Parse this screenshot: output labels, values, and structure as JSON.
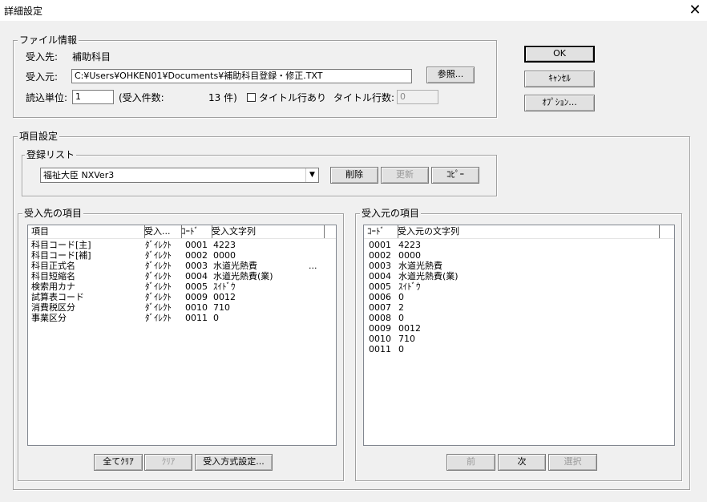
{
  "window": {
    "title": "詳細設定",
    "close_symbol": "✕"
  },
  "file_info": {
    "legend": "ファイル情報",
    "dest_label": "受入先:",
    "dest_value": "補助科目",
    "source_label": "受入元:",
    "source_value": "C:¥Users¥OHKEN01¥Documents¥補助科目登録・修正.TXT",
    "browse_button": "参照...",
    "unit_label": "読込単位:",
    "unit_value": "1",
    "count_prefix": "(受入件数:",
    "count_value": "13 件)",
    "title_row_label": "タイトル行あり",
    "title_row_count_label": "タイトル行数:",
    "title_row_count_value": "0"
  },
  "actions": {
    "ok": "OK",
    "cancel": "ｷｬﾝｾﾙ",
    "options": "ｵﾌﾟｼｮﾝ..."
  },
  "item_settings": {
    "legend": "項目設定",
    "registration": {
      "legend": "登録リスト",
      "selected": "福祉大臣 NXVer3",
      "delete_button": "削除",
      "update_button": "更新",
      "copy_button": "ｺﾋﾟｰ"
    },
    "dest_items": {
      "legend": "受入先の項目",
      "columns": [
        "項目",
        "受入...",
        "ｺｰﾄﾞ",
        "受入文字列"
      ],
      "rows": [
        [
          "科目コード[主]",
          "ﾀﾞｲﾚｸﾄ",
          "0001",
          "4223"
        ],
        [
          "科目コード[補]",
          "ﾀﾞｲﾚｸﾄ",
          "0002",
          "0000"
        ],
        [
          "科目正式名",
          "ﾀﾞｲﾚｸﾄ",
          "0003",
          "水道光熱費"
        ],
        [
          "科目短縮名",
          "ﾀﾞｲﾚｸﾄ",
          "0004",
          "水道光熱費(業)"
        ],
        [
          "検索用カナ",
          "ﾀﾞｲﾚｸﾄ",
          "0005",
          "ｽｲﾄﾞｳ"
        ],
        [
          "試算表コード",
          "ﾀﾞｲﾚｸﾄ",
          "0009",
          "0012"
        ],
        [
          "消費税区分",
          "ﾀﾞｲﾚｸﾄ",
          "0010",
          "710"
        ],
        [
          "事業区分",
          "ﾀﾞｲﾚｸﾄ",
          "0011",
          "0"
        ]
      ],
      "overflow_mark": "...",
      "clear_all_button": "全てｸﾘｱ",
      "clear_button": "ｸﾘｱ",
      "method_button": "受入方式設定..."
    },
    "source_items": {
      "legend": "受入元の項目",
      "columns": [
        "ｺｰﾄﾞ",
        "受入元の文字列"
      ],
      "rows": [
        [
          "0001",
          "4223"
        ],
        [
          "0002",
          "0000"
        ],
        [
          "0003",
          "水道光熱費"
        ],
        [
          "0004",
          "水道光熱費(業)"
        ],
        [
          "0005",
          "ｽｲﾄﾞｳ"
        ],
        [
          "0006",
          "0"
        ],
        [
          "0007",
          "2"
        ],
        [
          "0008",
          "0"
        ],
        [
          "0009",
          "0012"
        ],
        [
          "0010",
          "710"
        ],
        [
          "0011",
          "0"
        ]
      ],
      "prev_button": "前",
      "next_button": "次",
      "select_button": "選択"
    }
  }
}
